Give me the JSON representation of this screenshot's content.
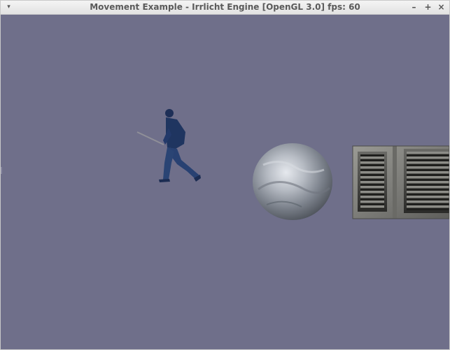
{
  "window": {
    "title": "Movement Example - Irrlicht Engine [OpenGL 3.0] fps: 60"
  },
  "titlebar_buttons": {
    "menu_icon": "▾",
    "minimize_icon": "–",
    "maximize_icon": "+",
    "close_icon": "×"
  },
  "scene": {
    "background_color": "#6f6f8a",
    "objects": [
      "ninja-character",
      "textured-sphere",
      "textured-cube"
    ]
  }
}
